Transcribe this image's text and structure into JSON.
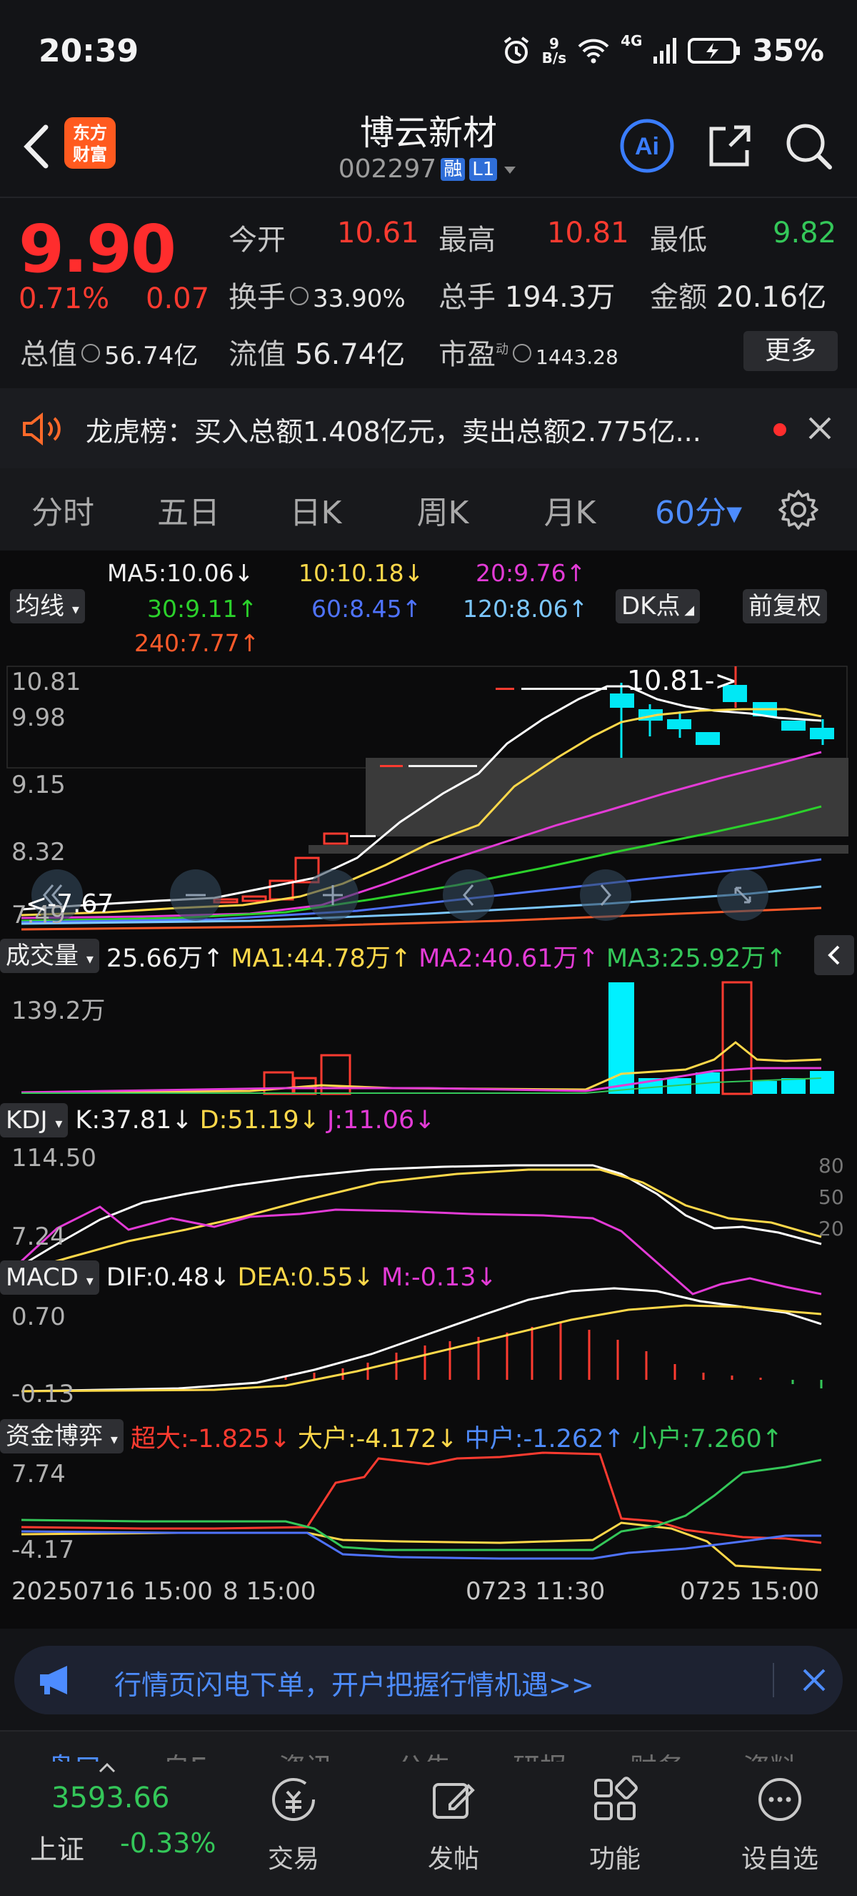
{
  "status_bar": {
    "time": "20:39",
    "net_speed_value": "9",
    "net_speed_unit": "B/s",
    "network": "4G",
    "battery": "35%"
  },
  "header": {
    "logo_line1": "东方",
    "logo_line2": "财富",
    "title": "博云新材",
    "code": "002297",
    "tag_margin": "融",
    "tag_level": "L1"
  },
  "quote": {
    "price": "9.90",
    "change_pct": "0.71%",
    "change": "0.07",
    "open_label": "今开",
    "open": "10.61",
    "high_label": "最高",
    "high": "10.81",
    "low_label": "最低",
    "low": "9.82",
    "turnover_label": "换手",
    "turnover": "33.90%",
    "volume_label": "总手",
    "volume": "194.3万",
    "amount_label": "金额",
    "amount": "20.16亿",
    "mktcap_label": "总值",
    "mktcap": "56.74亿",
    "float_label": "流值",
    "float": "56.74亿",
    "pe_label": "市盈",
    "pe_sup": "动",
    "pe": "1443.28",
    "more_label": "更多"
  },
  "dragon": {
    "text": "龙虎榜：买入总额1.408亿元，卖出总额2.775亿..."
  },
  "tabs": [
    "分时",
    "五日",
    "日K",
    "周K",
    "月K",
    "60分▾"
  ],
  "ma_legend": {
    "ma5": "MA5:10.06↓",
    "ma10": "10:10.18↓",
    "ma20": "20:9.76↑",
    "ma30": "30:9.11↑",
    "ma60": "60:8.45↑",
    "ma120": "120:8.06↑",
    "ma240": "240:7.77↑",
    "ma_button": "均线",
    "dk_button": "DK点",
    "adj_button": "前复权"
  },
  "kline": {
    "y_labels": [
      "10.81",
      "9.98",
      "9.15",
      "8.32",
      "7.49"
    ],
    "high_marker": "10.81->",
    "low_marker": "<-7.67"
  },
  "volume": {
    "selector": "成交量",
    "vol": "25.66万↑",
    "ma1": "MA1:44.78万↑",
    "ma2": "MA2:40.61万↑",
    "ma3": "MA3:25.92万↑",
    "max_label": "139.2万"
  },
  "kdj": {
    "selector": "KDJ",
    "k": "K:37.81↓",
    "d": "D:51.19↓",
    "j": "J:11.06↓",
    "top": "114.50",
    "bottom": "7.24",
    "lv80": "80",
    "lv50": "50",
    "lv20": "20"
  },
  "macd": {
    "selector": "MACD",
    "dif": "DIF:0.48↓",
    "dea": "DEA:0.55↓",
    "m": "M:-0.13↓",
    "top": "0.70",
    "bottom": "-0.13"
  },
  "fund": {
    "selector": "资金博弈",
    "super": "超大:-1.825↓",
    "large": "大户:-4.172↓",
    "mid": "中户:-1.262↑",
    "small": "小户:7.260↑",
    "top": "7.74",
    "bottom": "-4.17"
  },
  "time_axis": {
    "t1": "20250716 15:00",
    "t2": "8 15:00",
    "t3": "0723 11:30",
    "t4": "0725 15:00"
  },
  "promo": {
    "text": "行情页闪电下单，开户把握行情机遇>>"
  },
  "bottom_nav": {
    "ghost_tabs": [
      "盘口",
      "自E",
      "资讯",
      "公告",
      "研报",
      "财务",
      "资料"
    ],
    "index_value": "3593.66",
    "index_name": "上证",
    "index_pct": "-0.33%",
    "items": [
      "交易",
      "发帖",
      "功能",
      "设自选"
    ]
  },
  "colors": {
    "up": "#ff3b30",
    "down": "#34c759",
    "ma5": "#ffffff",
    "ma10": "#ffd84a",
    "ma20": "#e33bd6",
    "ma30": "#2bd12b",
    "ma60": "#4f73ff",
    "ma120": "#7cc7ff",
    "ma240": "#ff5a2a",
    "vol_cyan": "#00f0ff"
  }
}
